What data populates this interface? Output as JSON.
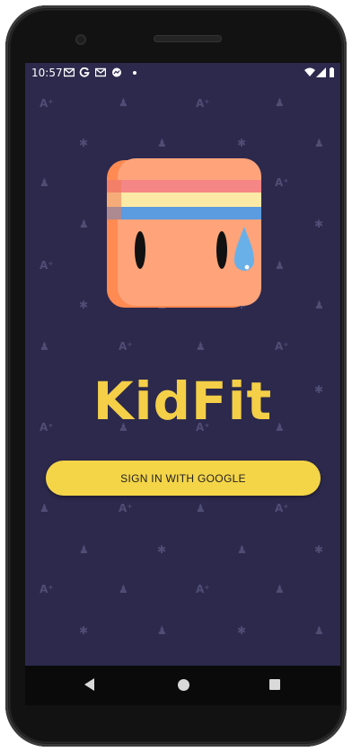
{
  "status_bar": {
    "time": "10:57",
    "notification_icons": [
      "gmail-icon",
      "google-icon",
      "gmail-icon",
      "messenger-icon",
      "dot-icon"
    ],
    "system_icons": [
      "wifi-icon",
      "signal-icon",
      "battery-icon"
    ]
  },
  "app": {
    "name": "KidFit",
    "sign_in_label": "SIGN IN WITH GOOGLE",
    "colors": {
      "background": "#2c294c",
      "brand": "#f4cf47",
      "button": "#f4d548",
      "logo_face": "#ffa07a",
      "sweat_drop": "#6ab0e8"
    }
  },
  "navigation": {
    "buttons": [
      "back",
      "home",
      "recents"
    ]
  }
}
